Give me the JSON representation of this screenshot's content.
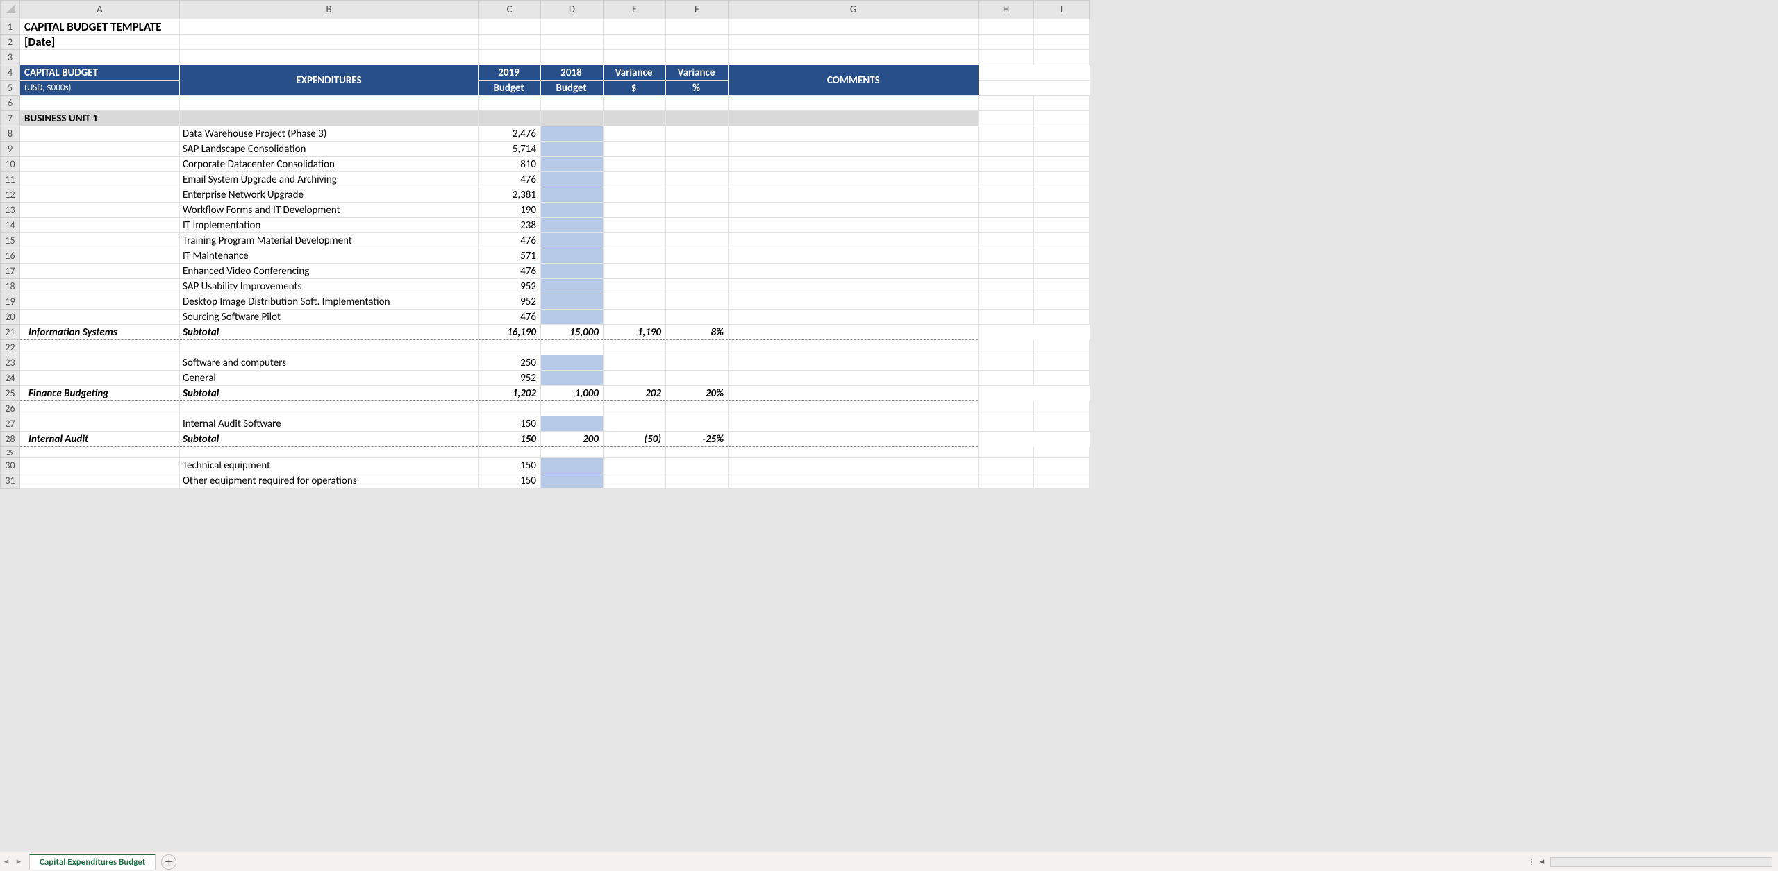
{
  "columns": [
    "A",
    "B",
    "C",
    "D",
    "E",
    "F",
    "G",
    "H",
    "I"
  ],
  "title_rows": {
    "r1": "CAPITAL BUDGET TEMPLATE",
    "r2": "[Date]"
  },
  "header": {
    "a4": "CAPITAL BUDGET",
    "a5": "(USD, $000s)",
    "b": "EXPENDITURES",
    "c4": "2019",
    "c5": "Budget",
    "d4": "2018",
    "d5": "Budget",
    "e4": "Variance",
    "e5": "$",
    "f4": "Variance",
    "f5": "%",
    "g": "COMMENTS"
  },
  "section1": "BUSINESS UNIT 1",
  "rows": {
    "r8": {
      "b": "Data Warehouse Project (Phase 3)",
      "c": "2,476"
    },
    "r9": {
      "b": "SAP Landscape Consolidation",
      "c": "5,714"
    },
    "r10": {
      "b": "Corporate Datacenter Consolidation",
      "c": "810"
    },
    "r11": {
      "b": "Email System Upgrade and Archiving",
      "c": "476"
    },
    "r12": {
      "b": "Enterprise Network Upgrade",
      "c": "2,381"
    },
    "r13": {
      "b": "Workflow Forms and IT Development",
      "c": "190"
    },
    "r14": {
      "b": "IT Implementation",
      "c": "238"
    },
    "r15": {
      "b": "Training Program Material Development",
      "c": "476"
    },
    "r16": {
      "b": "IT Maintenance",
      "c": "571"
    },
    "r17": {
      "b": "Enhanced Video Conferencing",
      "c": "476"
    },
    "r18": {
      "b": "SAP Usability Improvements",
      "c": "952"
    },
    "r19": {
      "b": "Desktop Image Distribution Soft. Implementation",
      "c": "952"
    },
    "r20": {
      "b": "Sourcing Software Pilot",
      "c": "476"
    },
    "r21": {
      "a": "Information Systems",
      "b": "Subtotal",
      "c": "16,190",
      "d": "15,000",
      "e": "1,190",
      "f": "8%"
    },
    "r23": {
      "b": "Software and computers",
      "c": "250"
    },
    "r24": {
      "b": "General",
      "c": "952"
    },
    "r25": {
      "a": "Finance Budgeting",
      "b": "Subtotal",
      "c": "1,202",
      "d": "1,000",
      "e": "202",
      "f": "20%"
    },
    "r27": {
      "b": "Internal Audit Software",
      "c": "150"
    },
    "r28": {
      "a": "Internal Audit",
      "b": "Subtotal",
      "c": "150",
      "d": "200",
      "e": "50",
      "f": "-25%"
    },
    "r30": {
      "b": "Technical equipment",
      "c": "150"
    },
    "r31": {
      "b": "Other equipment required for operations",
      "c": "150"
    }
  },
  "sheet_tab": "Capital Expenditures Budget"
}
